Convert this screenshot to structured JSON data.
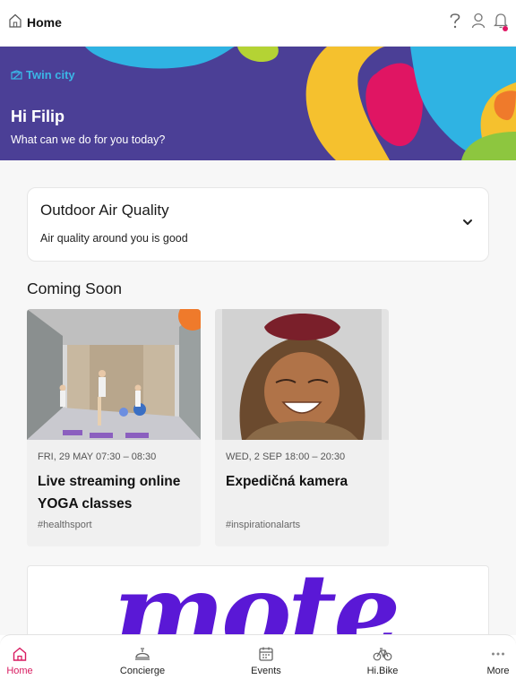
{
  "topbar": {
    "title": "Home"
  },
  "hero": {
    "city": "Twin city",
    "greeting": "Hi Filip",
    "subtitle": "What can we do for you today?"
  },
  "air_quality": {
    "title": "Outdoor Air Quality",
    "status": "Air quality around you is good"
  },
  "coming_soon": {
    "title": "Coming Soon",
    "events": [
      {
        "date": "FRI, 29 MAY 07:30 – 08:30",
        "title": "Live streaming online YOGA classes",
        "tag": "#healthsport"
      },
      {
        "date": "WED, 2 SEP 18:00 – 20:30",
        "title": "Expedičná kamera",
        "tag": "#inspirationalarts"
      }
    ]
  },
  "promo": {
    "text": "mote"
  },
  "tabs": [
    {
      "label": "Home",
      "icon": "home-icon",
      "active": true
    },
    {
      "label": "Concierge",
      "icon": "concierge-icon"
    },
    {
      "label": "Events",
      "icon": "calendar-icon"
    },
    {
      "label": "Hi.Bike",
      "icon": "bike-icon"
    },
    {
      "label": "More",
      "icon": "more-icon"
    }
  ],
  "colors": {
    "hero_bg": "#4b3f96",
    "accent": "#d81b60",
    "city": "#3bb6e6",
    "promo": "#5a18d6"
  }
}
